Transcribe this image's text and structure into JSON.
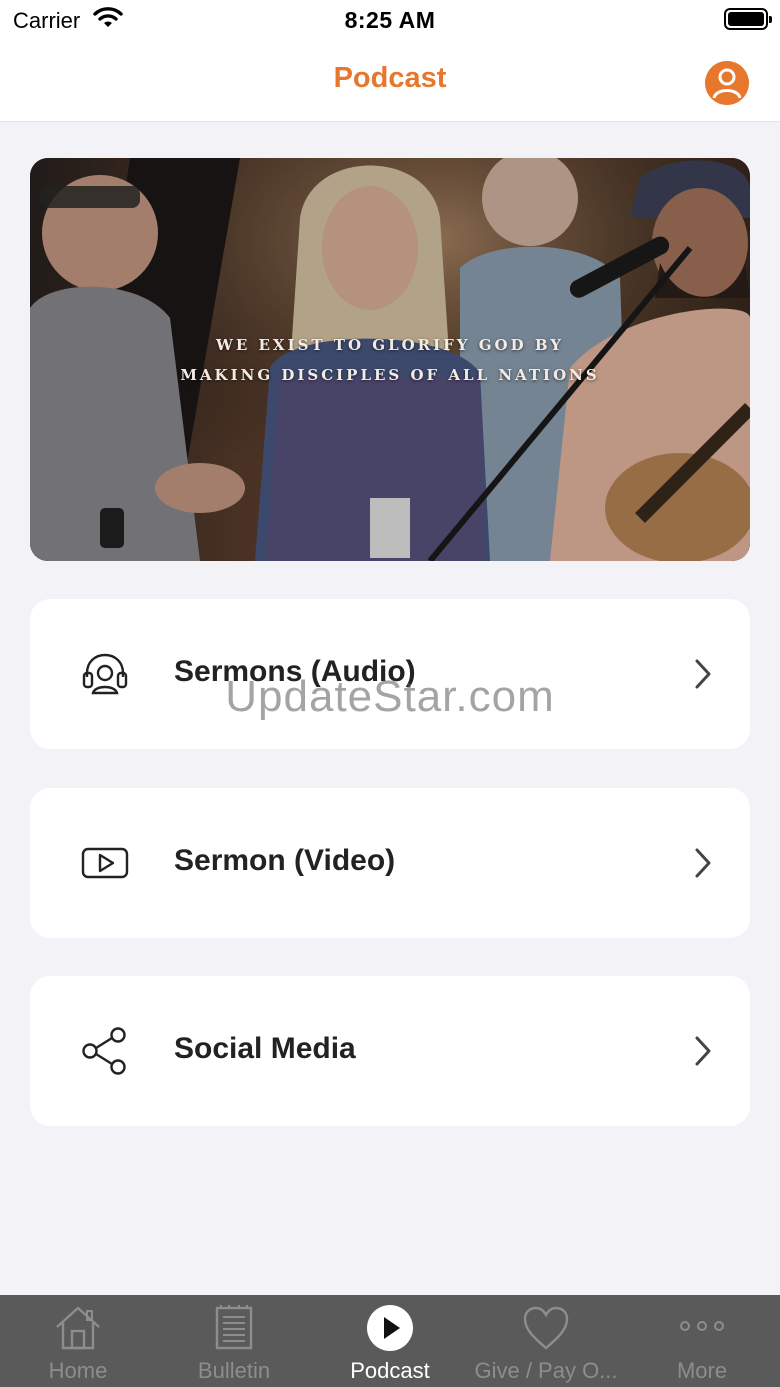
{
  "status_bar": {
    "carrier": "Carrier",
    "time": "8:25 AM"
  },
  "header": {
    "title": "Podcast",
    "accent_color": "#e8772e",
    "profile_icon": "person-icon"
  },
  "banner": {
    "line1": "WE EXIST TO GLORIFY GOD BY",
    "line2": "MAKING DISCIPLES OF ALL NATIONS"
  },
  "menu": {
    "items": [
      {
        "label": "Sermons (Audio)",
        "icon": "headphones-icon"
      },
      {
        "label": "Sermon (Video)",
        "icon": "video-play-icon"
      },
      {
        "label": "Social Media",
        "icon": "share-icon"
      }
    ]
  },
  "watermark": "UpdateStar.com",
  "tab_bar": {
    "background": "#5a5a5a",
    "tabs": [
      {
        "label": "Home",
        "icon": "home-icon",
        "active": false
      },
      {
        "label": "Bulletin",
        "icon": "bulletin-icon",
        "active": false
      },
      {
        "label": "Podcast",
        "icon": "play-circle-icon",
        "active": true
      },
      {
        "label": "Give / Pay O...",
        "icon": "heart-icon",
        "active": false
      },
      {
        "label": "More",
        "icon": "more-dots-icon",
        "active": false
      }
    ]
  }
}
